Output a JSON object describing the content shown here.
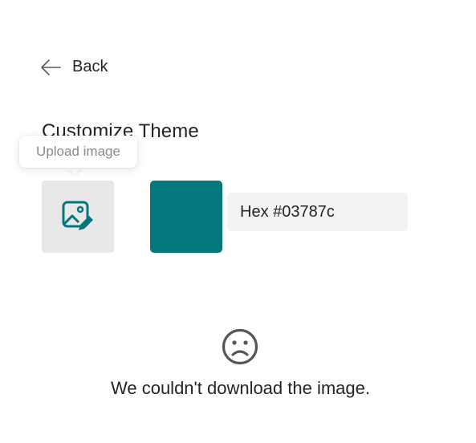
{
  "header": {
    "back_label": "Back",
    "back_icon": "arrow-left-icon"
  },
  "theme": {
    "title": "Customize Theme",
    "upload_tooltip": "Upload image",
    "upload_icon": "image-edit-icon",
    "accent_color": "#03787c",
    "hex_value": "Hex #03787c"
  },
  "error": {
    "icon": "sad-face-icon",
    "message": "We couldn't download the image."
  }
}
